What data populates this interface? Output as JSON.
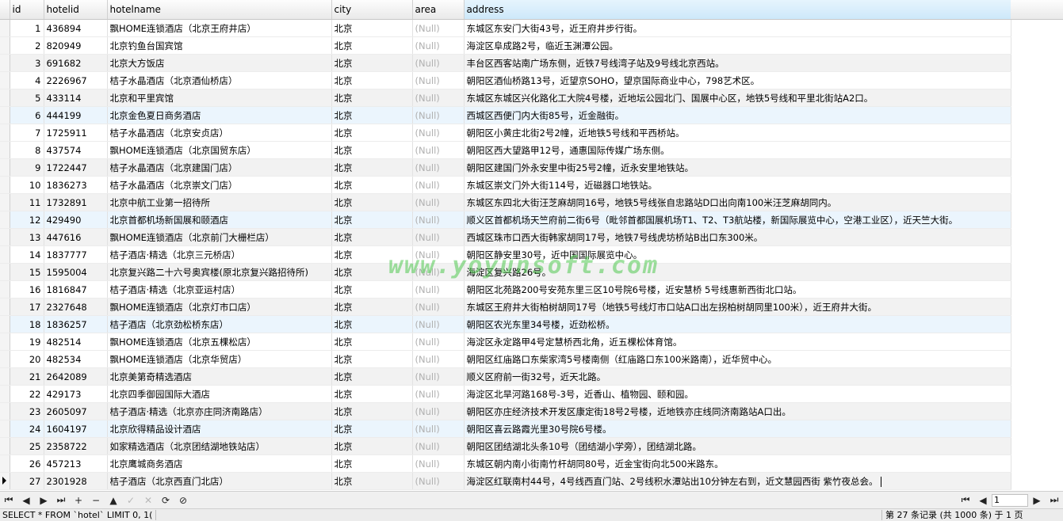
{
  "columns": [
    "id",
    "hotelid",
    "hotelname",
    "city",
    "area",
    "address"
  ],
  "highlighted_column": "address",
  "rows": [
    [
      "1",
      "436894",
      "飘HOME连锁酒店（北京王府井店）",
      "北京",
      "(Null)",
      "东城区东安门大街43号，近王府井步行街。"
    ],
    [
      "2",
      "820949",
      "北京钓鱼台国宾馆",
      "北京",
      "(Null)",
      "海淀区阜成路2号，临近玉渊潭公园。"
    ],
    [
      "3",
      "691682",
      "北京大方饭店",
      "北京",
      "(Null)",
      "丰台区西客站南广场东侧，近铁7号线湾子站及9号线北京西站。"
    ],
    [
      "4",
      "2226967",
      "桔子水晶酒店（北京酒仙桥店）",
      "北京",
      "(Null)",
      "朝阳区酒仙桥路13号，近望京SOHO，望京国际商业中心，798艺术区。"
    ],
    [
      "5",
      "433114",
      "北京和平里宾馆",
      "北京",
      "(Null)",
      "东城区东城区兴化路化工大院4号楼，近地坛公园北门、国展中心区，地铁5号线和平里北街站A2口。"
    ],
    [
      "6",
      "444199",
      "北京金色夏日商务酒店",
      "北京",
      "(Null)",
      "西城区西便门内大街85号，近金融街。"
    ],
    [
      "7",
      "1725911",
      "桔子水晶酒店（北京安贞店）",
      "北京",
      "(Null)",
      "朝阳区小黄庄北街2号2幢，近地铁5号线和平西桥站。"
    ],
    [
      "8",
      "437574",
      "飘HOME连锁酒店（北京国贸东店）",
      "北京",
      "(Null)",
      "朝阳区西大望路甲12号，通惠国际传媒广场东侧。"
    ],
    [
      "9",
      "1722447",
      "桔子水晶酒店（北京建国门店）",
      "北京",
      "(Null)",
      "朝阳区建国门外永安里中街25号2幢，近永安里地铁站。"
    ],
    [
      "10",
      "1836273",
      "桔子水晶酒店（北京崇文门店）",
      "北京",
      "(Null)",
      "东城区崇文门外大街114号，近磁器口地铁站。"
    ],
    [
      "11",
      "1732891",
      "北京中航工业第一招待所",
      "北京",
      "(Null)",
      "东城区东四北大街汪芝麻胡同16号，地铁5号线张自忠路站D口出向南100米汪芝麻胡同内。"
    ],
    [
      "12",
      "429490",
      "北京首都机场新国展和颐酒店",
      "北京",
      "(Null)",
      "顺义区首都机场天竺府前二街6号（毗邻首都国展机场T1、T2、T3航站楼，新国际展览中心，空港工业区），近天竺大街。"
    ],
    [
      "13",
      "447616",
      "飘HOME连锁酒店（北京前门大栅栏店）",
      "北京",
      "(Null)",
      "西城区珠市口西大街韩家胡同17号，地铁7号线虎坊桥站B出口东300米。"
    ],
    [
      "14",
      "1837777",
      "桔子酒店·精选（北京三元桥店）",
      "北京",
      "(Null)",
      "朝阳区静安里30号，近中国国际展览中心。"
    ],
    [
      "15",
      "1595004",
      "北京复兴路二十六号奥宾楼(原北京复兴路招待所)",
      "北京",
      "(Null)",
      "海淀区复兴路26号。"
    ],
    [
      "16",
      "1816847",
      "桔子酒店·精选（北京亚运村店）",
      "北京",
      "(Null)",
      "朝阳区北苑路200号安苑东里三区10号院6号楼，近安慧桥 5号线惠新西街北口站。"
    ],
    [
      "17",
      "2327648",
      "飘HOME连锁酒店（北京灯市口店）",
      "北京",
      "(Null)",
      "东城区王府井大街柏树胡同17号（地铁5号线灯市口站A口出左拐柏树胡同里100米），近王府井大街。"
    ],
    [
      "18",
      "1836257",
      "桔子酒店（北京劲松桥东店）",
      "北京",
      "(Null)",
      "朝阳区农光东里34号楼，近劲松桥。"
    ],
    [
      "19",
      "482514",
      "飘HOME连锁酒店（北京五棵松店）",
      "北京",
      "(Null)",
      "海淀区永定路甲4号定慧桥西北角，近五棵松体育馆。"
    ],
    [
      "20",
      "482534",
      "飘HOME连锁酒店（北京华贸店）",
      "北京",
      "(Null)",
      "朝阳区红庙路口东柴家湾5号楼南侧（红庙路口东100米路南），近华贸中心。"
    ],
    [
      "21",
      "2642089",
      "北京美第奇精选酒店",
      "北京",
      "(Null)",
      "顺义区府前一街32号，近天北路。"
    ],
    [
      "22",
      "429173",
      "北京四季御园国际大酒店",
      "北京",
      "(Null)",
      "海淀区北旱河路168号-3号，近香山、植物园、颐和园。"
    ],
    [
      "23",
      "2605097",
      "桔子酒店·精选（北京亦庄同济南路店）",
      "北京",
      "(Null)",
      "朝阳区亦庄经济技术开发区康定街18号2号楼，近地铁亦庄线同济南路站A口出。"
    ],
    [
      "24",
      "1604197",
      "北京欣得精品设计酒店",
      "北京",
      "(Null)",
      "朝阳区喜云路霞光里30号院6号楼。"
    ],
    [
      "25",
      "2358722",
      "如家精选酒店（北京团结湖地铁站店）",
      "北京",
      "(Null)",
      "朝阳区团结湖北头条10号（团结湖小学旁），团结湖北路。"
    ],
    [
      "26",
      "457213",
      "北京鹰城商务酒店",
      "北京",
      "(Null)",
      "东城区朝内南小街南竹杆胡同80号，近金宝街向北500米路东。"
    ],
    [
      "27",
      "2301928",
      "桔子酒店（北京西直门北店）",
      "北京",
      "(Null)",
      "海淀区红联南村44号，4号线西直门站、2号线积水潭站出10分钟左右到，近文慧园西街 紫竹夜总会。"
    ]
  ],
  "watermark": "www.yoyunsoft.com",
  "navbar": {
    "first": "⏮",
    "prev": "◀",
    "next": "▶",
    "last": "⏭",
    "add": "+",
    "delete": "−",
    "up": "▲",
    "apply": "✓",
    "cancel": "✕",
    "refresh": "⟳",
    "stop": "⊘",
    "page_first": "⏮",
    "page_prev": "◀",
    "page_value": "1",
    "page_next": "▶",
    "page_last": "⏭"
  },
  "status": {
    "sql": "SELECT * FROM `hotel` LIMIT 0, 1(",
    "records": "第 27 条记录 (共 1000 条) 于 1 页"
  }
}
